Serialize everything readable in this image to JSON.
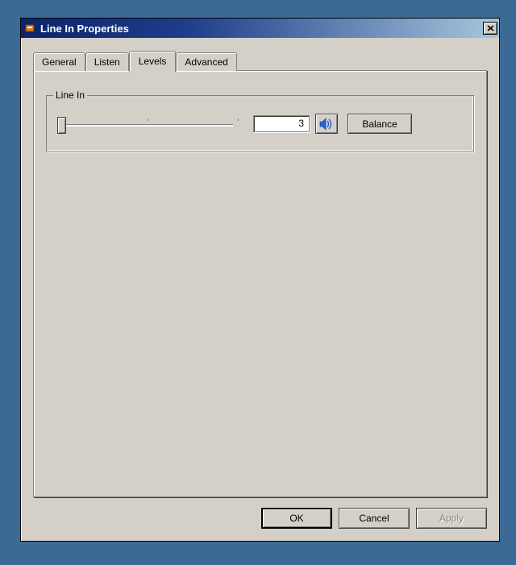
{
  "window": {
    "title": "Line In Properties"
  },
  "tabs": {
    "general": "General",
    "listen": "Listen",
    "levels": "Levels",
    "advanced": "Advanced",
    "active": "levels"
  },
  "group": {
    "label": "Line In",
    "value": "3",
    "slider_position_pct": 3,
    "balance_label": "Balance"
  },
  "buttons": {
    "ok": "OK",
    "cancel": "Cancel",
    "apply": "Apply"
  }
}
